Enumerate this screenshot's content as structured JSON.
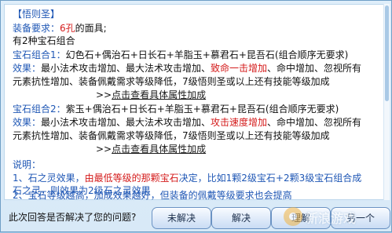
{
  "title": "【悟则圣】",
  "requirement": {
    "label": "装备要求：",
    "value": "6孔",
    "suffix": "的面具;"
  },
  "combo_intro": "有2种宝石组合",
  "combo1": {
    "label": "宝石组合1：",
    "gems": "幻色石+偶治石+日长石+羊脂玉+慕君石+昆吾石(组合顺序无要求)",
    "effect_label": "效果：",
    "effect_a": "最小法术攻击增加、最大法术攻击增加、",
    "effect_highlight": "致命一击增加",
    "effect_b": "、命中增加、忽视所有",
    "effect_line2": "元素抗性增加、装备佩戴需求等级降低，7级悟则圣或以上还有技能等级加成",
    "link": "点击查看具体属性加成"
  },
  "combo2": {
    "label": "宝石组合2：",
    "gems": "紫玉+偶治石+日长石+羊脂玉+慕君石+昆吾石(组合顺序无要求)",
    "effect_label": "效果：",
    "effect_a": "最小法术攻击增加、最大法术攻击增加、",
    "effect_highlight": "攻击速度增加",
    "effect_b": "、命中增加、忽视所有",
    "effect_line2": "元素抗性增加、装备佩戴需求等级降低，7级悟则圣或以上还有技能等级加成",
    "link": "点击查看具体属性加成"
  },
  "link_prefix": ">>",
  "notes": {
    "label": "说明：",
    "n1_a": "1、石之灵效果，",
    "n1_highlight": "由最低等级的那颗宝石",
    "n1_b": "决定，比如1颗2级宝石+2颗3级宝石组合成",
    "n1_line2": "石之灵，则效果为2级石之灵效果",
    "n2": "2、宝石等级越高，加成效果越好，但装备的佩戴等级要求也会提高"
  },
  "footer": {
    "question": "此次回答是否解决了您的问题?",
    "buttons": [
      "未解决",
      "解决",
      "理解",
      "另一个"
    ]
  },
  "watermark": "新浪游戏"
}
